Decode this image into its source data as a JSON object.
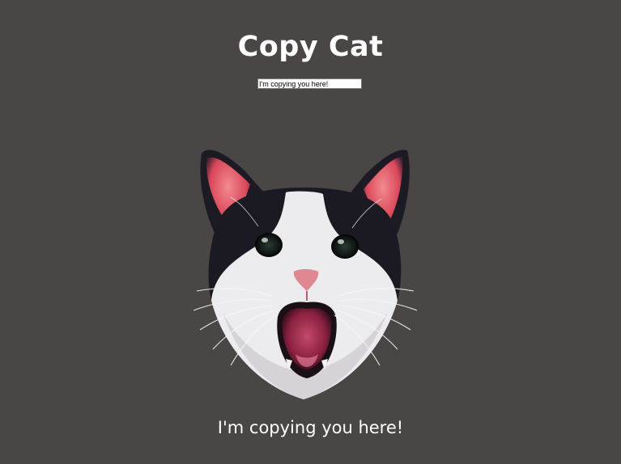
{
  "page": {
    "title": "Copy Cat",
    "background": "#4a4646"
  },
  "input": {
    "value": "I'm copying you here!"
  },
  "image": {
    "subject": "cat-face-icon"
  },
  "output": {
    "text": "I'm copying you here!"
  }
}
